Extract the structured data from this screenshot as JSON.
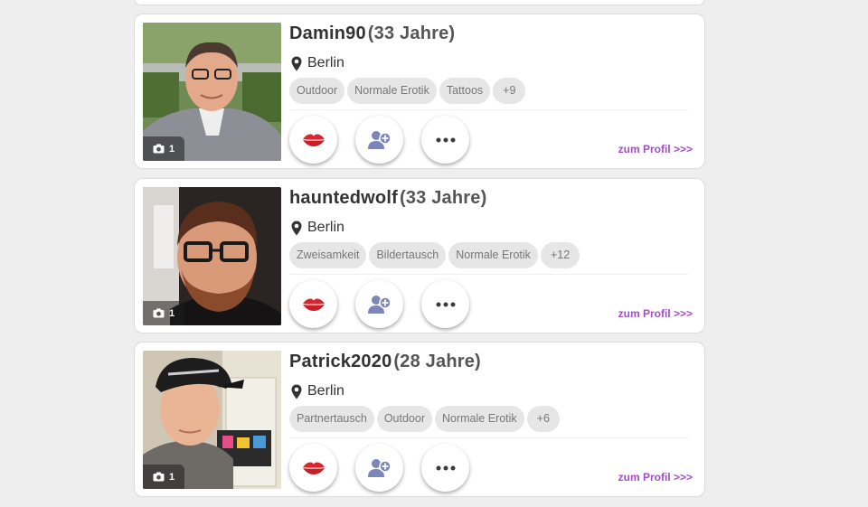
{
  "profiles": [
    {
      "name": "Damin90",
      "age": "(33 Jahre)",
      "location": "Berlin",
      "tags": [
        "Outdoor",
        "Normale Erotik",
        "Tattoos"
      ],
      "more_tags": "+9",
      "photo_count": "1",
      "profile_link": "zum Profil >>>"
    },
    {
      "name": "hauntedwolf",
      "age": "(33 Jahre)",
      "location": "Berlin",
      "tags": [
        "Zweisamkeit",
        "Bildertausch",
        "Normale Erotik"
      ],
      "more_tags": "+12",
      "photo_count": "1",
      "profile_link": "zum Profil >>>"
    },
    {
      "name": "Patrick2020",
      "age": "(28 Jahre)",
      "location": "Berlin",
      "tags": [
        "Partnertausch",
        "Outdoor",
        "Normale Erotik"
      ],
      "more_tags": "+6",
      "photo_count": "1",
      "profile_link": "zum Profil >>>"
    }
  ],
  "icons": {
    "photo_count": "camera-icon",
    "location": "map-pin-icon",
    "kiss_action": "lips-icon",
    "friend_action": "add-friend-icon",
    "more_action": "more-dots-icon"
  },
  "colors": {
    "link": "#a34bc9",
    "kiss": "#d8262e",
    "friend": "#7d86b8",
    "more": "#3a3a3a"
  }
}
